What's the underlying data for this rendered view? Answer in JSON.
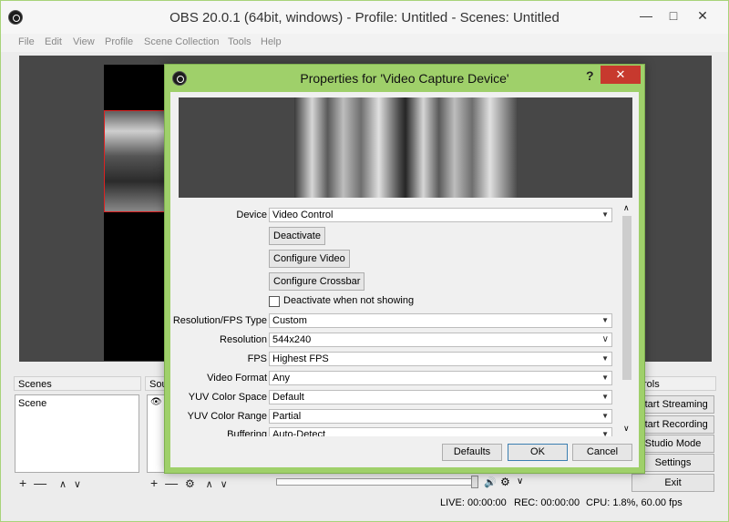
{
  "window": {
    "title": "OBS 20.0.1 (64bit, windows) - Profile: Untitled - Scenes: Untitled",
    "minimize": "—",
    "maximize": "□",
    "close": "✕"
  },
  "menu": [
    "File",
    "Edit",
    "View",
    "Profile",
    "Scene Collection",
    "Tools",
    "Help"
  ],
  "docks": {
    "scenes_title": "Scenes",
    "scenes": [
      "Scene"
    ],
    "sources_title": "Sou",
    "controls_title": "rols",
    "toolbar_add": "+",
    "toolbar_remove": "—",
    "toolbar_up": "∧",
    "toolbar_down": "∨",
    "gear": "⚙",
    "speaker": "🔊"
  },
  "controls": {
    "start_streaming": "Start Streaming",
    "start_recording": "Start Recording",
    "studio_mode": "Studio Mode",
    "settings": "Settings",
    "exit": "Exit"
  },
  "status": {
    "live": "LIVE: 00:00:00",
    "rec": "REC: 00:00:00",
    "cpu": "CPU: 1.8%, 60.00 fps"
  },
  "dialog": {
    "title": "Properties for 'Video Capture Device'",
    "help": "?",
    "close": "✕",
    "device_label": "Device",
    "device_value": "Video Control",
    "deactivate_button": "Deactivate",
    "configure_video_button": "Configure Video",
    "configure_crossbar_button": "Configure Crossbar",
    "deactivate_when_not_showing": "Deactivate when not showing",
    "fields": [
      {
        "label": "Resolution/FPS Type",
        "value": "Custom"
      },
      {
        "label": "Resolution",
        "value": "544x240"
      },
      {
        "label": "FPS",
        "value": "Highest FPS"
      },
      {
        "label": "Video Format",
        "value": "Any"
      },
      {
        "label": "YUV Color Space",
        "value": "Default"
      },
      {
        "label": "YUV Color Range",
        "value": "Partial"
      },
      {
        "label": "Buffering",
        "value": "Auto-Detect"
      }
    ],
    "defaults_button": "Defaults",
    "ok_button": "OK",
    "cancel_button": "Cancel"
  },
  "colors": {
    "desktop": "#9fd06a",
    "preview_bg": "#474747",
    "close_red": "#c7392e"
  }
}
